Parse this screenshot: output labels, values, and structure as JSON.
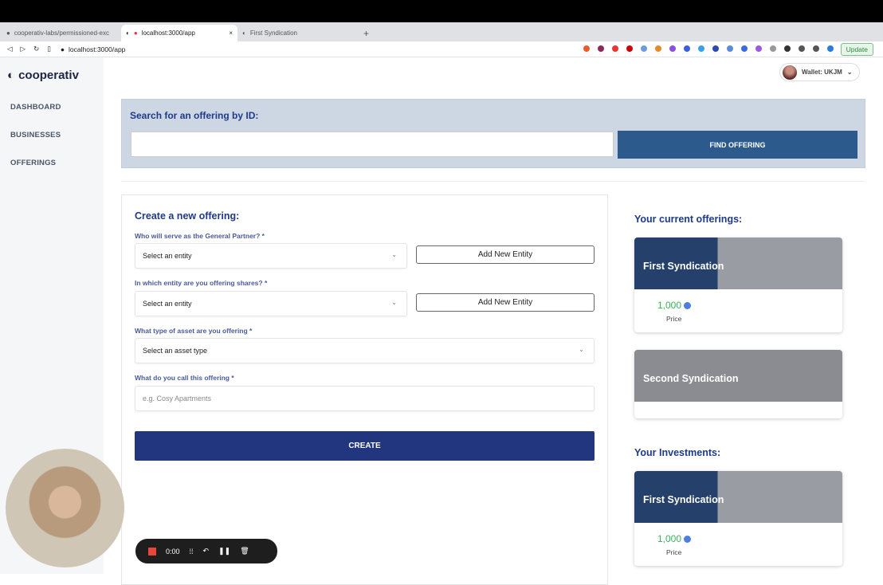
{
  "browser": {
    "tabs": [
      {
        "label": "cooperativ-labs/permissioned-exc"
      },
      {
        "label": "localhost:3000/app"
      },
      {
        "label": "First Syndication"
      }
    ],
    "new_tab": "+",
    "url": "localhost:3000/app",
    "update_label": "Update"
  },
  "app": {
    "logo": "cooperativ",
    "nav": [
      {
        "label": "DASHBOARD"
      },
      {
        "label": "BUSINESSES"
      },
      {
        "label": "OFFERINGS"
      }
    ],
    "wallet": "Wallet: UKJM"
  },
  "search": {
    "title": "Search for an offering by ID:",
    "value": "",
    "button": "FIND OFFERING"
  },
  "form": {
    "title": "Create a new offering:",
    "gp_label": "Who will serve as the General Partner? *",
    "gp_value": "Select an entity",
    "entity_label": "In which entity are you offering shares? *",
    "entity_value": "Select an entity",
    "add_entity": "Add New Entity",
    "asset_label": "What type of asset are you offering *",
    "asset_value": "Select an asset type",
    "name_label": "What do you call this offering *",
    "name_placeholder": "e.g. Cosy Apartments",
    "create": "CREATE"
  },
  "offerings": {
    "title": "Your current offerings:",
    "items": [
      {
        "name": "First Syndication",
        "price": "1,000",
        "price_label": "Price"
      },
      {
        "name": "Second Syndication"
      }
    ]
  },
  "investments": {
    "title": "Your Investments:",
    "items": [
      {
        "name": "First Syndication",
        "price": "1,000",
        "price_label": "Price"
      }
    ]
  },
  "recorder": {
    "time": "0:00"
  },
  "colors": {
    "primary": "#22367f",
    "heading": "#1e3a8a",
    "find_button": "#2c5a8c",
    "price": "#3cb35c"
  }
}
